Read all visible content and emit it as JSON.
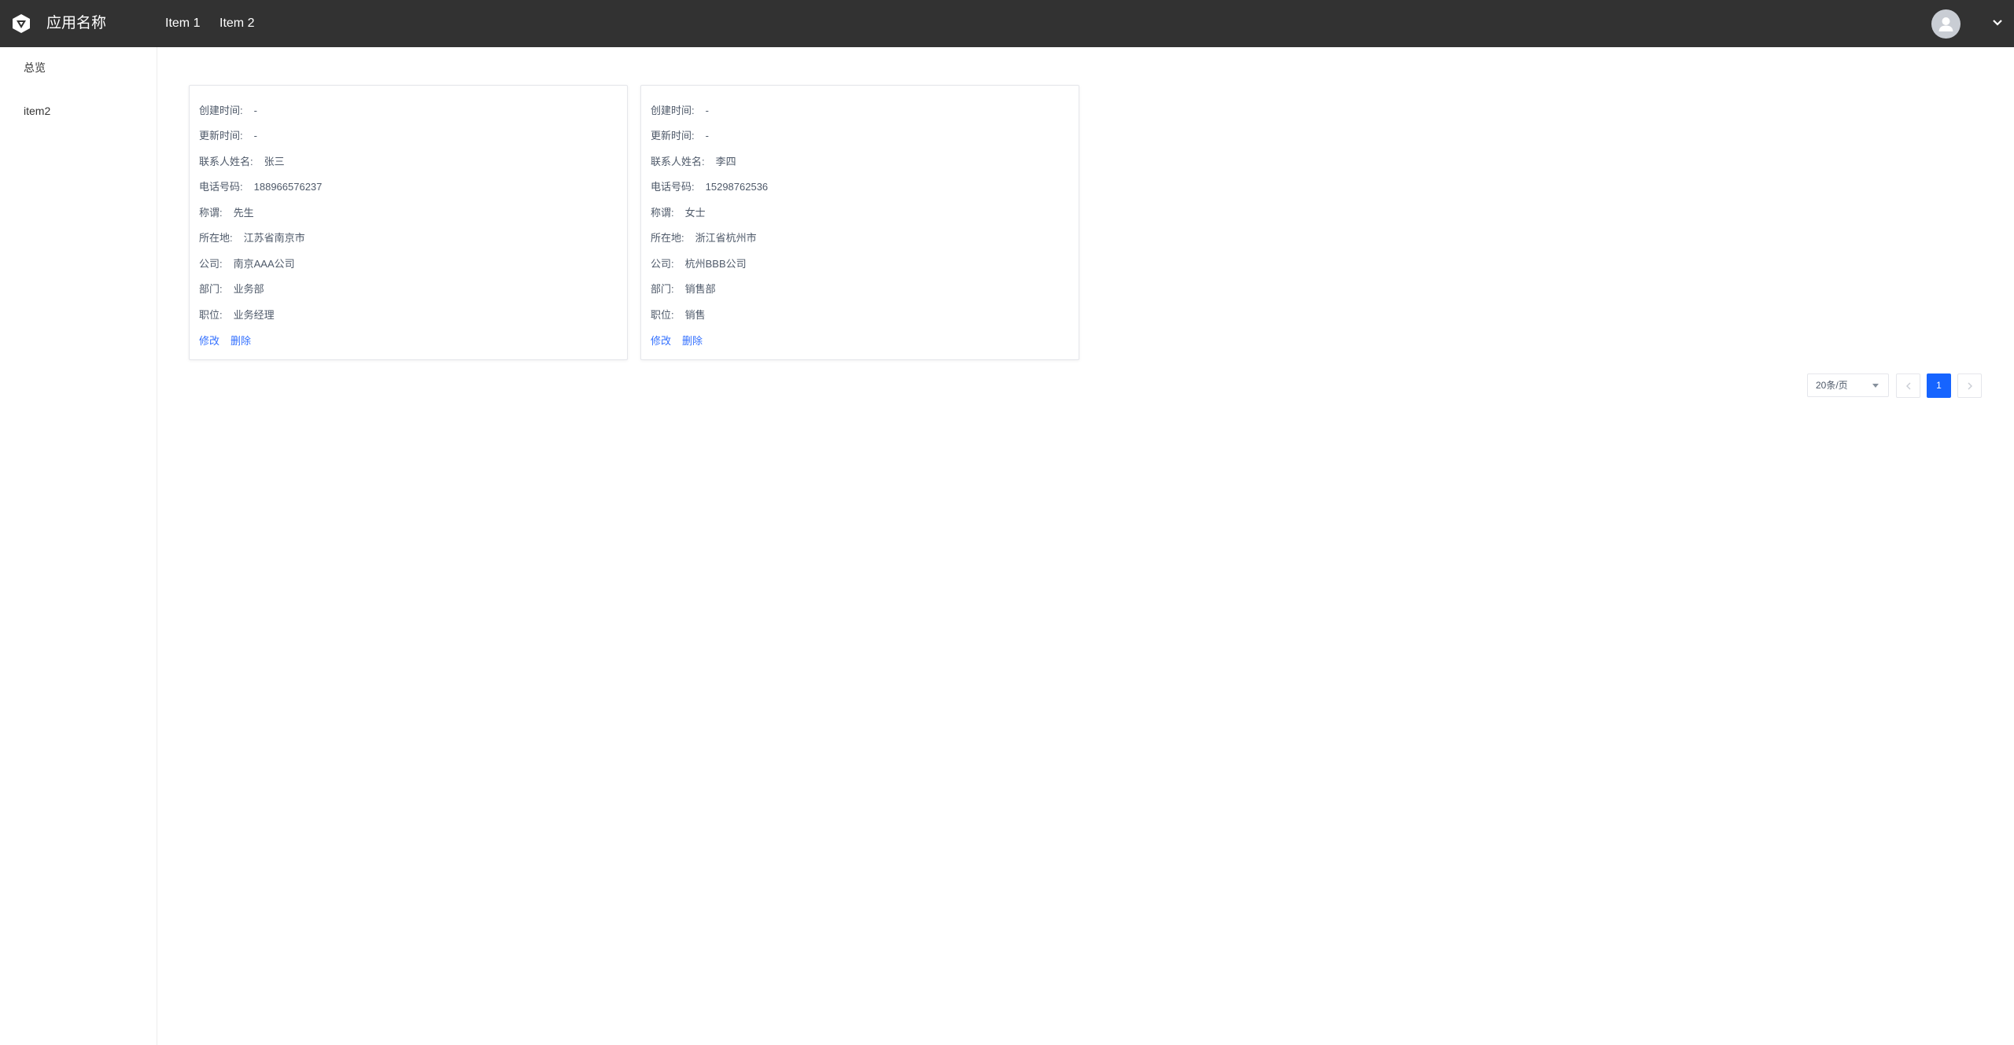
{
  "header": {
    "app_name": "应用名称",
    "nav": [
      {
        "label": "Item 1"
      },
      {
        "label": "Item 2"
      }
    ]
  },
  "sidebar": {
    "items": [
      {
        "label": "总览"
      },
      {
        "label": "item2"
      }
    ]
  },
  "cards": [
    {
      "fields": [
        {
          "label": "创建时间:",
          "value": "-"
        },
        {
          "label": "更新时间:",
          "value": "-"
        },
        {
          "label": "联系人姓名:",
          "value": "张三"
        },
        {
          "label": "电话号码:",
          "value": "188966576237"
        },
        {
          "label": "称谓:",
          "value": "先生"
        },
        {
          "label": "所在地:",
          "value": "江苏省南京市"
        },
        {
          "label": "公司:",
          "value": "南京AAA公司"
        },
        {
          "label": "部门:",
          "value": "业务部"
        },
        {
          "label": "职位:",
          "value": "业务经理"
        }
      ],
      "edit_label": "修改",
      "delete_label": "删除"
    },
    {
      "fields": [
        {
          "label": "创建时间:",
          "value": "-"
        },
        {
          "label": "更新时间:",
          "value": "-"
        },
        {
          "label": "联系人姓名:",
          "value": "李四"
        },
        {
          "label": "电话号码:",
          "value": "15298762536"
        },
        {
          "label": "称谓:",
          "value": "女士"
        },
        {
          "label": "所在地:",
          "value": "浙江省杭州市"
        },
        {
          "label": "公司:",
          "value": "杭州BBB公司"
        },
        {
          "label": "部门:",
          "value": "销售部"
        },
        {
          "label": "职位:",
          "value": "销售"
        }
      ],
      "edit_label": "修改",
      "delete_label": "删除"
    }
  ],
  "pagination": {
    "page_size": "20条/页",
    "prev_icon": "chevron-left-icon",
    "next_icon": "chevron-right-icon",
    "pages": [
      "1"
    ],
    "current_page": "1"
  },
  "colors": {
    "topbar": "#323232",
    "link": "#3370ff",
    "active_page": "#1664ff"
  }
}
